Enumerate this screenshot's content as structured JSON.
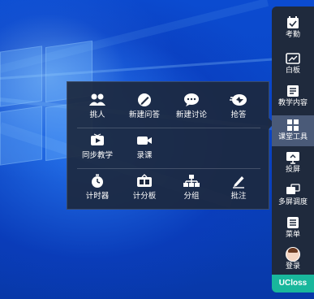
{
  "colors": {
    "desktop_blue": "#0a45c4",
    "panel_bg": "#1c283e",
    "sidebar_bg": "#1f2a3d",
    "active_item": "#4a5a78",
    "brand_green": "#19b79c"
  },
  "tool_panel": {
    "rows": [
      [
        {
          "label": "挑人",
          "icon": "people-icon"
        },
        {
          "label": "新建问答",
          "icon": "edit-icon"
        },
        {
          "label": "新建讨论",
          "icon": "chat-icon"
        },
        {
          "label": "抢答",
          "icon": "race-answer-icon"
        }
      ],
      [
        {
          "label": "同步教学",
          "icon": "sync-teaching-icon"
        },
        {
          "label": "录课",
          "icon": "video-camera-icon"
        }
      ],
      [
        {
          "label": "计时器",
          "icon": "timer-icon"
        },
        {
          "label": "计分板",
          "icon": "scoreboard-icon"
        },
        {
          "label": "分组",
          "icon": "group-tree-icon"
        },
        {
          "label": "批注",
          "icon": "annotate-pen-icon"
        }
      ]
    ]
  },
  "sidebar": {
    "items": [
      {
        "label": "考勤",
        "icon": "attendance-icon"
      },
      {
        "label": "白板",
        "icon": "whiteboard-icon"
      },
      {
        "label": "教学内容",
        "icon": "teaching-content-icon"
      },
      {
        "label": "课堂工具",
        "icon": "classroom-tools-icon",
        "active": true
      },
      {
        "label": "投屏",
        "icon": "cast-screen-icon"
      },
      {
        "label": "多屏调度",
        "icon": "multi-screen-icon"
      },
      {
        "label": "菜单",
        "icon": "menu-icon"
      },
      {
        "label": "登录",
        "icon": "avatar"
      }
    ],
    "brand": "UCloss"
  }
}
